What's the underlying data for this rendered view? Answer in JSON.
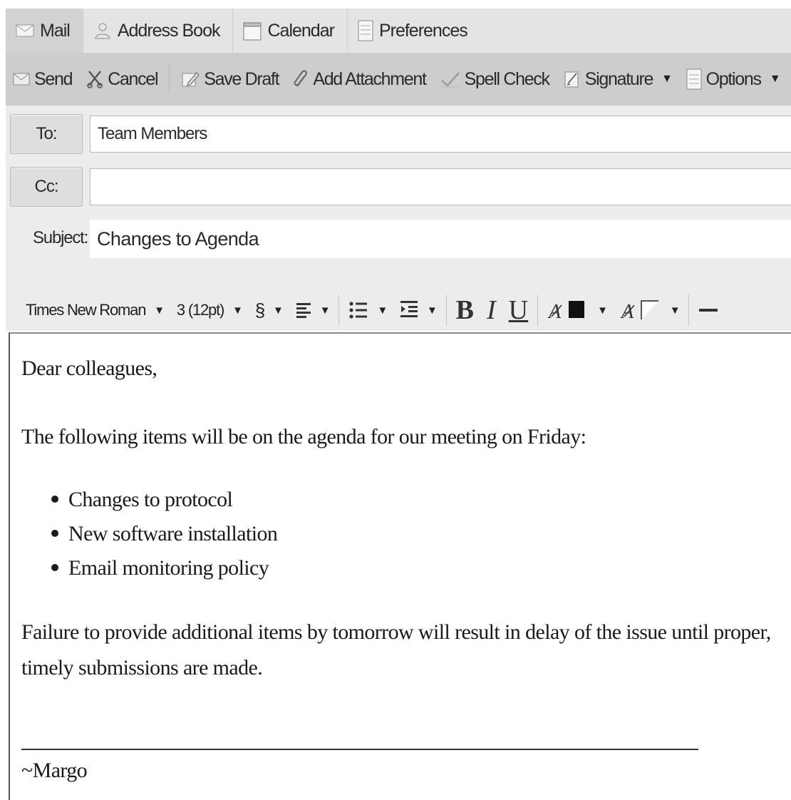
{
  "tabs": [
    {
      "label": "Mail",
      "icon": "mail-icon",
      "active": true
    },
    {
      "label": "Address Book",
      "icon": "person-icon",
      "active": false
    },
    {
      "label": "Calendar",
      "icon": "calendar-icon",
      "active": false
    },
    {
      "label": "Preferences",
      "icon": "document-icon",
      "active": false
    }
  ],
  "toolbar": {
    "send": "Send",
    "cancel": "Cancel",
    "save_draft": "Save Draft",
    "add_attachment": "Add Attachment",
    "spell_check": "Spell Check",
    "signature": "Signature",
    "options": "Options"
  },
  "headers": {
    "to_button": "To:",
    "to_value": "Team Members",
    "cc_button": "Cc:",
    "cc_value": "",
    "subject_label": "Subject:",
    "subject_value": "Changes to Agenda"
  },
  "format": {
    "font_family": "Times New Roman",
    "font_size": "3 (12pt)",
    "paragraph": "§",
    "bold": "B",
    "italic": "I",
    "underline": "U",
    "text_color": "#111111",
    "highlight_color": "#ffffff"
  },
  "body": {
    "greeting": "Dear colleagues,",
    "intro": "The following items will be on the agenda for our meeting on Friday:",
    "items": [
      "Changes to protocol",
      "New software installation",
      "Email monitoring policy"
    ],
    "closing_line1": "Failure to provide additional items by tomorrow will result in delay of the issue until proper,",
    "closing_line2": "timely submissions are made.",
    "signature": "~Margo"
  }
}
